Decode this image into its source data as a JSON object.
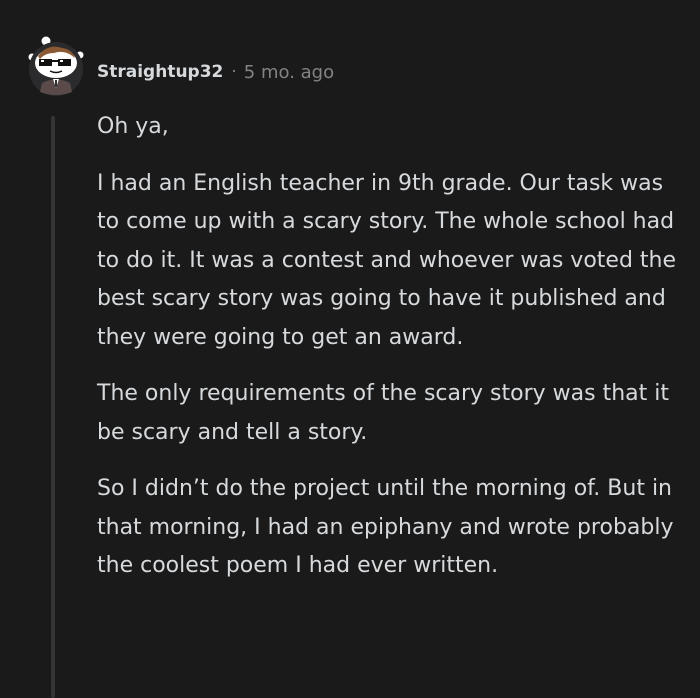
{
  "comment": {
    "username": "Straightup32",
    "separator": "·",
    "timestamp": "5 mo. ago",
    "paragraphs": [
      "Oh ya,",
      "I had an English teacher in 9th grade. Our task was to come up with a scary story. The whole school had to do it. It was a contest and whoever was voted the best scary story was going to have it published and they were going to get an award.",
      "The only requirements of the scary story was that it be scary and tell a story.",
      "So I didn’t do the project until the morning of. But in that morning, I had an epiphany and wrote probably the coolest poem I had ever written."
    ]
  },
  "colors": {
    "background": "#1a1a1b",
    "text": "#d7dadc",
    "meta_text": "#818384",
    "thread_line": "#343536"
  },
  "icons": {
    "avatar": "snoo-avatar-with-sunglasses"
  }
}
